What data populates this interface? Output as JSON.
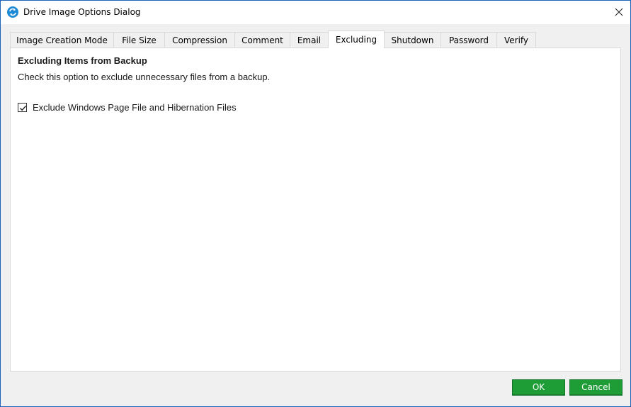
{
  "window": {
    "title": "Drive Image Options Dialog",
    "icon": "app-icon",
    "close_icon": "close-icon"
  },
  "tabs": [
    {
      "label": "Image Creation Mode",
      "active": false
    },
    {
      "label": "File Size",
      "active": false
    },
    {
      "label": "Compression",
      "active": false
    },
    {
      "label": "Comment",
      "active": false
    },
    {
      "label": "Email",
      "active": false
    },
    {
      "label": "Excluding",
      "active": true
    },
    {
      "label": "Shutdown",
      "active": false
    },
    {
      "label": "Password",
      "active": false
    },
    {
      "label": "Verify",
      "active": false
    }
  ],
  "panel": {
    "heading": "Excluding Items from Backup",
    "description": "Check this option to exclude unnecessary files from a backup.",
    "checkbox": {
      "label": "Exclude Windows Page File and Hibernation Files",
      "checked": true
    }
  },
  "buttons": {
    "ok_label": "OK",
    "cancel_label": "Cancel",
    "color": "#1e9c36"
  }
}
